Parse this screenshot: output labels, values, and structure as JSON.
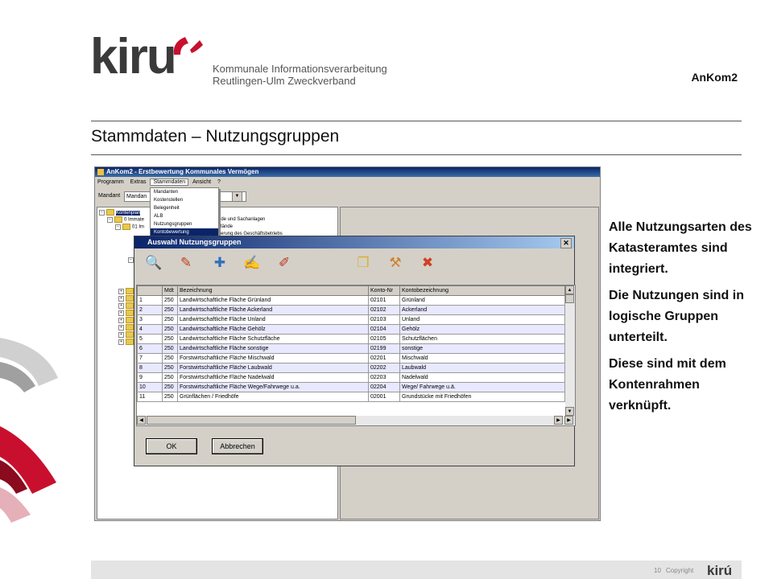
{
  "header": {
    "logo_text": "kiru",
    "org_line1": "Kommunale Informationsverarbeitung",
    "org_line2": "Reutlingen-Ulm Zweckverband",
    "product": "AnKom2",
    "title": "Stammdaten – Nutzungsgruppen"
  },
  "side_text": [
    "Alle Nutzungsarten des Katasteramtes sind integriert.",
    "Die Nutzungen sind in logische Gruppen unterteilt.",
    "Diese sind mit dem Kontenrahmen verknüpft."
  ],
  "footer": {
    "page": "10",
    "copyright": "Copyright",
    "logo": "kirú"
  },
  "app": {
    "title": "AnKom2 - Erstbewertung Kommunales Vermögen",
    "menu": [
      "Programm",
      "Extras",
      "Stammdaten",
      "Ansicht",
      "?"
    ],
    "mandant_label": "Mandant",
    "mandant_value": "Mandan",
    "stammdaten_menu": [
      "Mandanten",
      "Kostenstellen",
      "Belegenheit",
      "ALB",
      "Nutzungsgruppen",
      "Kontobewertung"
    ],
    "tree": [
      "Kontenplan",
      "0 Immate",
      "01 Im",
      "nde und Sachanlagen",
      "stände",
      "iterung des Geschäftsbetriebs"
    ]
  },
  "dialog": {
    "title": "Auswahl Nutzungsgruppen",
    "columns": [
      "",
      "Mdt",
      "Bezeichnung",
      "Konto-Nr",
      "Kontobezeichnung"
    ],
    "rows": [
      [
        "1",
        "250",
        "Landwirtschaftliche Fläche Grünland",
        "02101",
        "Grünland"
      ],
      [
        "2",
        "250",
        "Landwirtschaftliche Fläche Ackerland",
        "02102",
        "Ackerland"
      ],
      [
        "3",
        "250",
        "Landwirtschaftliche Fläche Unland",
        "02103",
        "Unland"
      ],
      [
        "4",
        "250",
        "Landwirtschaftliche Fläche Gehölz",
        "02104",
        "Gehölz"
      ],
      [
        "5",
        "250",
        "Landwirtschaftliche Fläche Schutzfläche",
        "02105",
        "Schutzflächen"
      ],
      [
        "6",
        "250",
        "Landwirtschaftliche Fläche sonstige",
        "02199",
        "sonstige"
      ],
      [
        "7",
        "250",
        "Forstwirtschaftliche Fläche Mischwald",
        "02201",
        "Mischwald"
      ],
      [
        "8",
        "250",
        "Forstwirtschaftliche Fläche Laubwald",
        "02202",
        "Laubwald"
      ],
      [
        "9",
        "250",
        "Forstwirtschaftliche Fläche Nadelwald",
        "02203",
        "Nadelwald"
      ],
      [
        "10",
        "250",
        "Forstwirtschaftliche Fläche Wege/Fahrwege u.a.",
        "02204",
        "Wege/ Fahrwege u.ä."
      ],
      [
        "11",
        "250",
        "Grünflächen / Friedhöfe",
        "02001",
        "Grundstücke mit Friedhöfen"
      ]
    ],
    "ok_label": "OK",
    "cancel_label": "Abbrechen"
  }
}
